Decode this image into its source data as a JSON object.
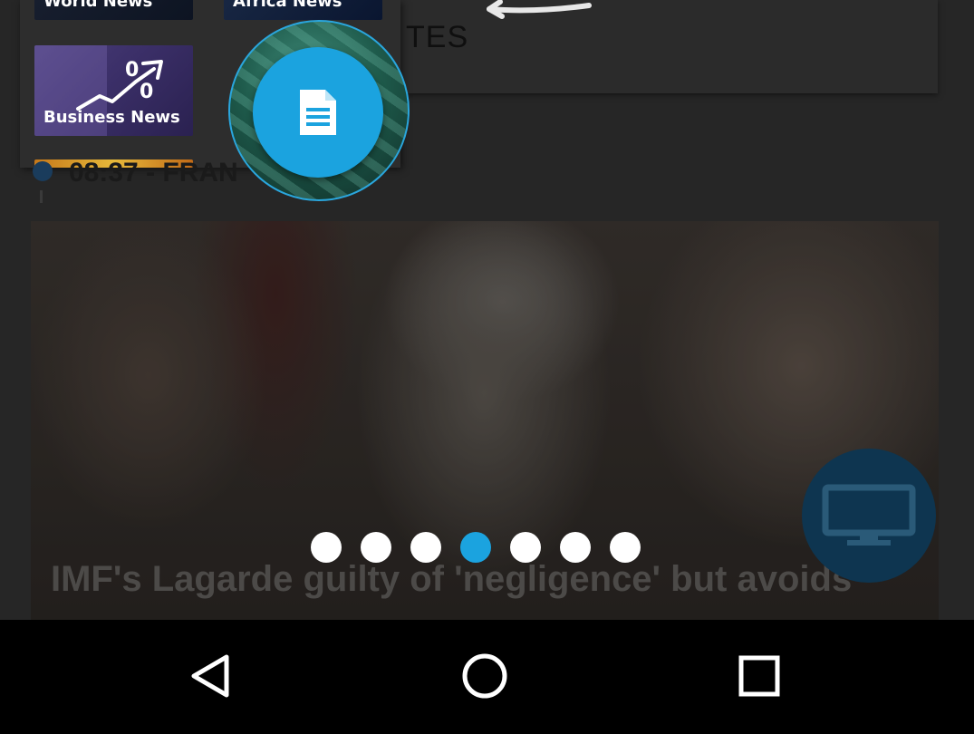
{
  "top_card": {
    "text": "TES"
  },
  "categories": {
    "tiles": [
      {
        "label": "World News"
      },
      {
        "label": "Africa News"
      },
      {
        "label": "Business News"
      }
    ]
  },
  "time_row": {
    "text": "08:37 - FRAN"
  },
  "fab": {
    "icon": "document-icon"
  },
  "article": {
    "headline": "IMF's Lagarde guilty of 'negligence' but avoids"
  },
  "pager": {
    "count": 7,
    "active_index": 3
  },
  "tv_button": {
    "icon": "tv-icon"
  },
  "nav": {
    "back": "back-icon",
    "home": "home-icon",
    "recent": "recent-apps-icon"
  },
  "colors": {
    "accent": "#1ba3df",
    "tv_bg": "#0e3550",
    "background": "#262626"
  }
}
